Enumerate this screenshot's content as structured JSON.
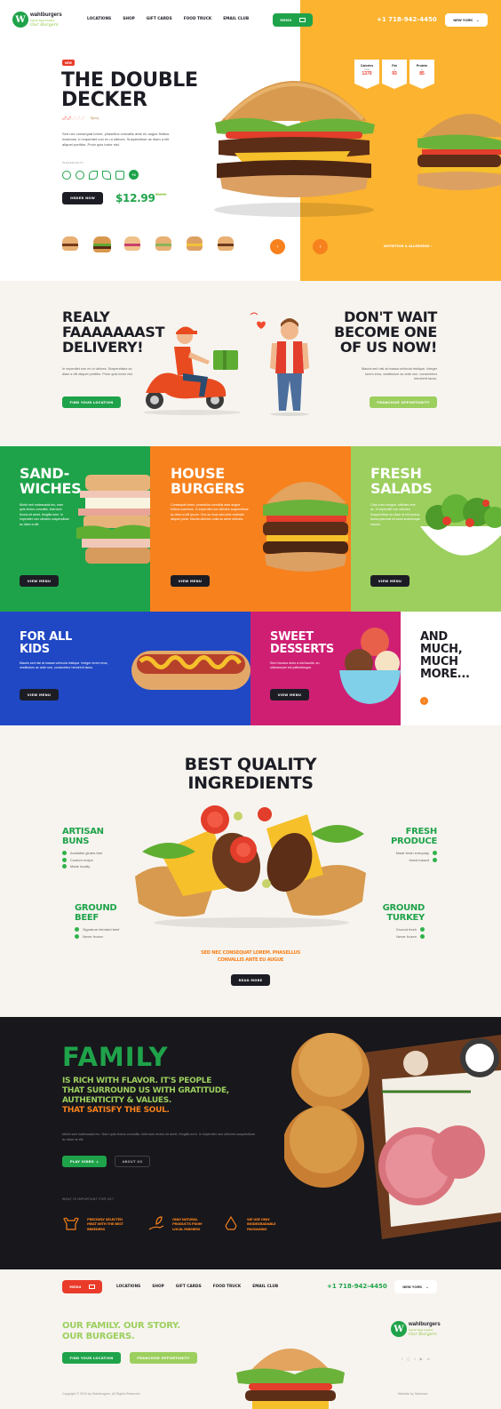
{
  "brand": {
    "name": "wahlburgers",
    "tagline1": "Family Style Healthy",
    "tagline2": "Our Burgers"
  },
  "nav": {
    "items": [
      "LOCATIONS",
      "SHOP",
      "GIFT CARDS",
      "FOOD TRUCK",
      "EMAIL CLUB"
    ],
    "menu": "MENU",
    "phone": "+1 718-942-4450",
    "city": "NEW YORK"
  },
  "hero": {
    "badge": "NEW",
    "title1": "THE DOUBLE",
    "title2": "DECKER",
    "spicy": "Spicy",
    "desc": "Sed nec consequat lorem, phasellus convallis ante eu augue finibus maximus. In imperdiet non ex ut ultrices. Suspendisse ac diam a elit aliquet porttitor. Proin quis tortor nisi.",
    "ingredients_label": "INGREDIENTS",
    "more_count": "+3",
    "order": "ORDER NOW",
    "price": "$12.99",
    "old_price": "$14.99",
    "nutrition": [
      {
        "label": "Calories",
        "unit": "kcal",
        "value": "1370"
      },
      {
        "label": "Fat",
        "unit": "g",
        "value": "93"
      },
      {
        "label": "Protein",
        "unit": "g",
        "value": "85"
      }
    ],
    "nutrition_link": "NUTRITION & ALLERGENS"
  },
  "delivery": {
    "left_title1": "REALY",
    "left_title2": "FAAAAAAAST",
    "left_title3": "DELIVERY!",
    "left_desc": "In imperdiet non ex ut ultrices. Suspendisse ac diam a elit aliquet porttitor. Proin quis tortor nisi.",
    "left_btn": "FIND YOUR LOCATION",
    "right_title1": "DON'T WAIT",
    "right_title2": "BECOME ONE",
    "right_title3": "OF US NOW!",
    "right_desc": "Mauris sed nisl at massa vehicula tristique. Integer lorem eros, vestibulum ac ante non, consectetur hendrerit lacus.",
    "right_btn": "FRANCHISE OPPORTUNITY"
  },
  "categories": [
    {
      "title1": "SAND-",
      "title2": "WICHES",
      "desc": "Morbi sed malesuada leo, nam quis lectus convallis, interdum lectus sit amet, fringilla sem. In imperdiet non ultricies suspendisse ac diam a elit.",
      "btn": "VIEW MENU",
      "color": "#1fa34a"
    },
    {
      "title1": "HOUSE",
      "title2": "BURGERS",
      "desc": "Consequat lorem, phasellus convallis ante augue finibus maximus. In imperdiet non ultricies suspendisse ac diam a elit ipsum. Orci ac risus sed ante molestie aliquet porta. Mauris ultricies nulla ac amet ultricies.",
      "btn": "VIEW MENU",
      "color": "#f7811d"
    },
    {
      "title1": "FRESH",
      "title2": "SALADS",
      "desc": "Cras a leo congue, ultricies erat ac, in imperdiet non ultricies. Suspendisse ac diam at elit cursus lectus placerat sit amet scelerisque mauris.",
      "btn": "VIEW MENU",
      "color": "#9ccf5e"
    },
    {
      "title1": "FOR ALL",
      "title2": "KIDS",
      "desc": "Mauris sed nisl at massa vehicula tristique. Integer lorem eros, vestibulum ac ante non, consectetur hendrerit lacus.",
      "btn": "VIEW MENU",
      "color": "#2048c4"
    },
    {
      "title1": "SWEET",
      "title2": "DESSERTS",
      "desc": "Sed rhoncus dolor a nisl iaculis, eu ullamcorper est pellentesque.",
      "btn": "VIEW MENU",
      "color": "#cf1f73"
    }
  ],
  "more": {
    "line1": "AND",
    "line2": "MUCH,",
    "line3": "MUCH",
    "line4": "MORE..."
  },
  "ingredients": {
    "title1": "BEST QUALITY",
    "title2": "INGREDIENTS",
    "buns": {
      "title1": "ARTISAN",
      "title2": "BUNS",
      "items": [
        "Available gluten-free",
        "Custom recipe",
        "Made locally"
      ]
    },
    "produce": {
      "title1": "FRESH",
      "title2": "PRODUCE",
      "items": [
        "Made fresh everyday",
        "Hand tossed"
      ]
    },
    "beef": {
      "title1": "GROUND",
      "title2": "BEEF",
      "items": [
        "Signature blended beef",
        "Never frozen"
      ]
    },
    "turkey": {
      "title1": "GROUND",
      "title2": "TURKEY",
      "items": [
        "Ground fresh",
        "Never frozen"
      ]
    },
    "tag1": "SED NEC CONSEQUAT LOREM. PHASELLUS",
    "tag2": "CONVALLIS ANTE EU AUGUE",
    "btn": "READ MORE"
  },
  "family": {
    "title": "FAMILY",
    "sub1": "IS RICH WITH FLAVOR. IT'S PEOPLE",
    "sub2": "THAT SURROUND US WITH GRATITUDE,",
    "sub3": "AUTHENTICITY & VALUES.",
    "sub4": "THAT SATISFY THE SOUL.",
    "desc": "Morbi sed malesuada leo. Nam quis lectus convallis, interdum lectus sit amet, fringilla sem. In imperdiet non ultricies suspendisse ac diam at elit.",
    "play": "PLAY VIDEO",
    "about": "ABOUT US",
    "important": "WHAT IS IMPORTANT FOR US?",
    "features": [
      {
        "l1": "PRECISELY SELECTED",
        "l2": "MEAT WITH THE BEST",
        "l3": "BREEDERS"
      },
      {
        "l1": "ONLY NATURAL",
        "l2": "PRODUCTS FROM",
        "l3": "LOCAL FARMERS"
      },
      {
        "l1": "WE USE ONLY",
        "l2": "BIODEGRADABLE",
        "l3": "PACKAGING"
      }
    ]
  },
  "footer": {
    "story1": "OUR FAMILY. OUR STORY.",
    "story2": "OUR BURGERS.",
    "btn1": "FIND YOUR LOCATION",
    "btn2": "FRANCHISE OPPORTUNITY",
    "copyright": "Copyright © 2019 by Wahlburgers. All Rights Reserved.",
    "credit": "Website by Sashown"
  },
  "colors": {
    "green": "#1fa34a",
    "orange": "#f7811d",
    "yellow": "#fbb330",
    "dark": "#1c1c24",
    "cream": "#f7f4ef"
  }
}
